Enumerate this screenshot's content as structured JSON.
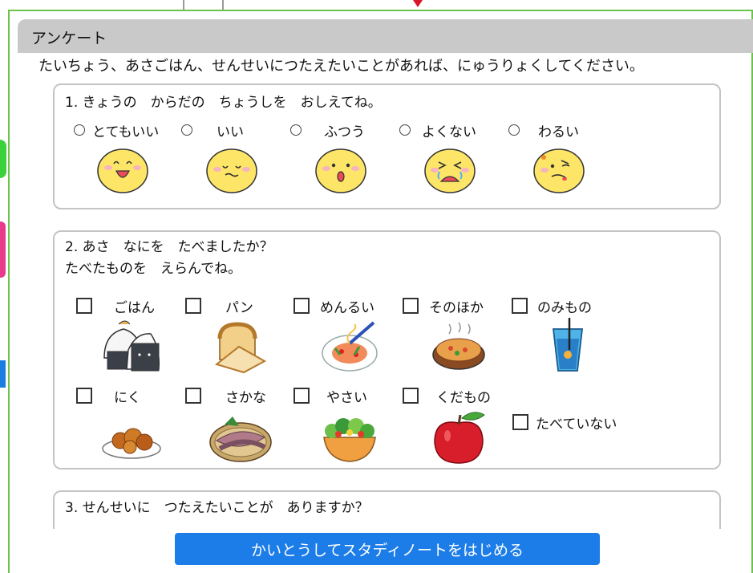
{
  "window": {
    "title": "アンケート"
  },
  "instruction": "たいちょう、あさごはん、せんせいにつたえたいことがあれば、にゅうりょくしてください。",
  "q1": {
    "question": "1. きょうの　からだの　ちょうしを　おしえてね。",
    "options": [
      {
        "label": "とてもいい",
        "icon": "very-happy-face-icon"
      },
      {
        "label": "いい",
        "icon": "content-face-icon"
      },
      {
        "label": "ふつう",
        "icon": "neutral-face-icon"
      },
      {
        "label": "よくない",
        "icon": "crying-face-icon"
      },
      {
        "label": "わるい",
        "icon": "sick-face-icon"
      }
    ]
  },
  "q2": {
    "question_line1": "2. あさ　なにを　たべましたか？",
    "question_line2": "たべたものを　えらんでね。",
    "row1": [
      {
        "label": "ごはん",
        "icon": "rice-ball-icon"
      },
      {
        "label": "パン",
        "icon": "bread-icon"
      },
      {
        "label": "めんるい",
        "icon": "pasta-icon"
      },
      {
        "label": "そのほか",
        "icon": "gratin-icon"
      },
      {
        "label": "のみもの",
        "icon": "drink-icon"
      }
    ],
    "row2": [
      {
        "label": "にく",
        "icon": "fried-chicken-icon"
      },
      {
        "label": "さかな",
        "icon": "fish-icon"
      },
      {
        "label": "やさい",
        "icon": "salad-icon"
      },
      {
        "label": "くだもの",
        "icon": "apple-icon"
      }
    ],
    "none_label": "たべていない"
  },
  "q3": {
    "question": "3. せんせいに　つたえたいことが　ありますか？"
  },
  "footer": {
    "start_button": "かいとうしてスタディノートをはじめる"
  },
  "colors": {
    "accent": "#1d7de8",
    "frame": "#6cc24a",
    "face": "#fde567"
  }
}
